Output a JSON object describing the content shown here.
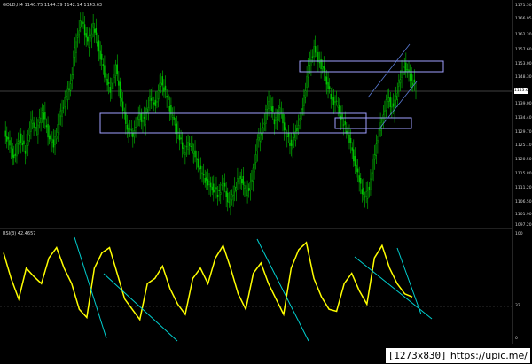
{
  "header": {
    "symbol_tf": "GOLD,H4",
    "ohlc": [
      "1140.75",
      "1144.39",
      "1142.14",
      "1143.63"
    ]
  },
  "rsi_header": "RSI(3) 42.4657",
  "price_axis": [
    "1171.50",
    "1166.95",
    "1162.30",
    "1157.60",
    "1153.00",
    "1148.30",
    "1143.63",
    "1139.00",
    "1134.40",
    "1129.70",
    "1125.10",
    "1120.50",
    "1115.80",
    "1111.20",
    "1106.50",
    "1101.90",
    "1097.20"
  ],
  "rsi_axis": [
    "100",
    "32",
    "0"
  ],
  "current_price": "1143.63",
  "watermark": {
    "size": "[1273x830]",
    "url": "https://upic.me/"
  },
  "colors": {
    "bg": "#000000",
    "candle": "#00c800",
    "rsi": "#ffff00",
    "trend": "#00d0d0",
    "box": "#a0a0ff",
    "grid": "#808080"
  },
  "chart_data": {
    "type": "line",
    "price_series": [
      1130,
      1125,
      1120,
      1127,
      1122,
      1132,
      1129,
      1136,
      1128,
      1124,
      1133,
      1139,
      1145,
      1160,
      1166,
      1158,
      1164,
      1156,
      1148,
      1142,
      1150,
      1138,
      1130,
      1128,
      1134,
      1132,
      1140,
      1138,
      1146,
      1140,
      1133,
      1128,
      1122,
      1125,
      1120,
      1115,
      1112,
      1110,
      1108,
      1111,
      1104,
      1110,
      1114,
      1108,
      1112,
      1125,
      1130,
      1140,
      1132,
      1136,
      1128,
      1124,
      1130,
      1137,
      1150,
      1156,
      1152,
      1147,
      1140,
      1138,
      1132,
      1128,
      1120,
      1112,
      1106,
      1112,
      1125,
      1133,
      1140,
      1136,
      1145,
      1151,
      1147,
      1143
    ],
    "rsi_series": [
      85,
      60,
      40,
      70,
      62,
      55,
      80,
      90,
      70,
      55,
      30,
      22,
      70,
      85,
      90,
      65,
      40,
      30,
      20,
      55,
      60,
      72,
      50,
      35,
      25,
      60,
      70,
      55,
      80,
      92,
      70,
      45,
      30,
      65,
      75,
      55,
      40,
      25,
      70,
      88,
      95,
      60,
      42,
      30,
      28,
      55,
      65,
      48,
      35,
      80,
      92,
      70,
      55,
      45,
      42
    ],
    "ylim": [
      1097.2,
      1171.5
    ],
    "rsi_ylim": [
      0,
      100
    ]
  }
}
